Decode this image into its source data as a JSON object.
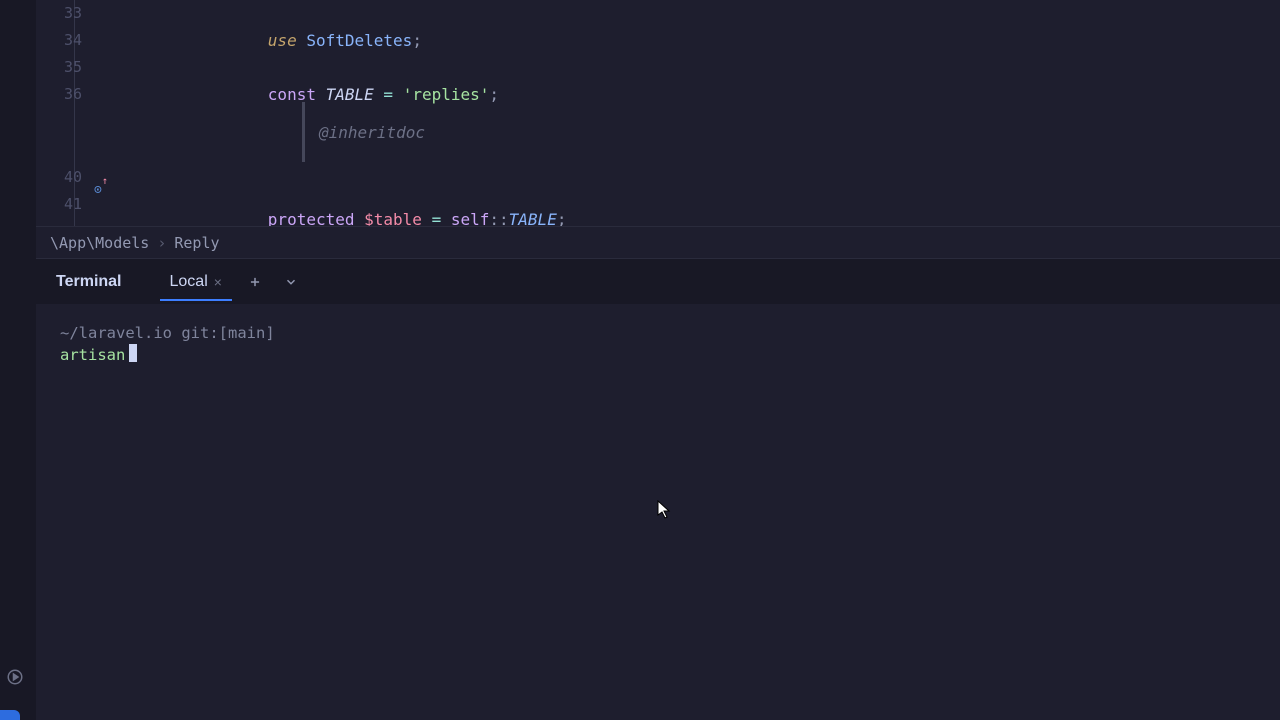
{
  "editor": {
    "lines": [
      {
        "n": 33
      },
      {
        "n": 34
      },
      {
        "n": 35
      },
      {
        "n": 36
      },
      {
        "n": ""
      },
      {
        "n": ""
      },
      {
        "n": 40
      },
      {
        "n": 41
      }
    ],
    "use_kw": "use",
    "softdeletes": "SoftDeletes",
    "const_kw": "const",
    "table_const": "TABLE",
    "eq": "=",
    "replies": "'replies'",
    "inheritdoc": "@inheritdoc",
    "protected_kw": "protected",
    "var_table": "$table",
    "self_kw": "self",
    "dcolon": "::",
    "semi": ";"
  },
  "breadcrumb": {
    "ns": "\\App\\Models",
    "cls": "Reply"
  },
  "tabs": {
    "panel": "Terminal",
    "local": "Local"
  },
  "terminal": {
    "path": "~/laravel.io",
    "git": "git:",
    "branch": "[main]",
    "cmd": "artisan"
  }
}
